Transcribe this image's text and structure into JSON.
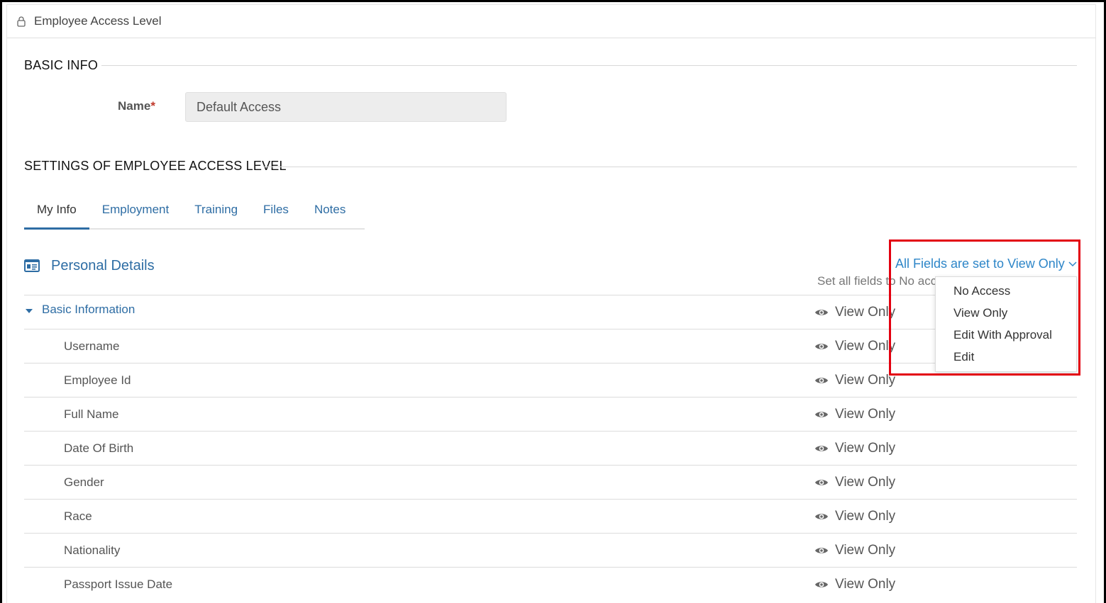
{
  "header": {
    "title": "Employee Access Level",
    "icon": "lock-icon"
  },
  "basic_info": {
    "section_title": "BASIC INFO",
    "name_label": "Name",
    "required_mark": "*",
    "name_value": "Default Access"
  },
  "settings": {
    "section_title": "SETTINGS OF EMPLOYEE ACCESS LEVEL",
    "tabs": [
      {
        "label": "My Info",
        "active": true
      },
      {
        "label": "Employment",
        "active": false
      },
      {
        "label": "Training",
        "active": false
      },
      {
        "label": "Files",
        "active": false
      },
      {
        "label": "Notes",
        "active": false
      }
    ]
  },
  "personal_details": {
    "title": "Personal Details",
    "set_all_text": "Set all fields to No acc",
    "bulk_dropdown": {
      "label": "All Fields are set to View Only",
      "options": [
        "No Access",
        "View Only",
        "Edit With Approval",
        "Edit"
      ]
    },
    "group": {
      "label": "Basic Information",
      "access": "View Only"
    },
    "fields": [
      {
        "label": "Username",
        "access": "View Only"
      },
      {
        "label": "Employee Id",
        "access": "View Only"
      },
      {
        "label": "Full Name",
        "access": "View Only"
      },
      {
        "label": "Date Of Birth",
        "access": "View Only"
      },
      {
        "label": "Gender",
        "access": "View Only"
      },
      {
        "label": "Race",
        "access": "View Only"
      },
      {
        "label": "Nationality",
        "access": "View Only"
      },
      {
        "label": "Passport Issue Date",
        "access": "View Only"
      }
    ]
  },
  "colors": {
    "link": "#2e6da4",
    "highlight": "#e3000f",
    "required": "#c0392b"
  }
}
